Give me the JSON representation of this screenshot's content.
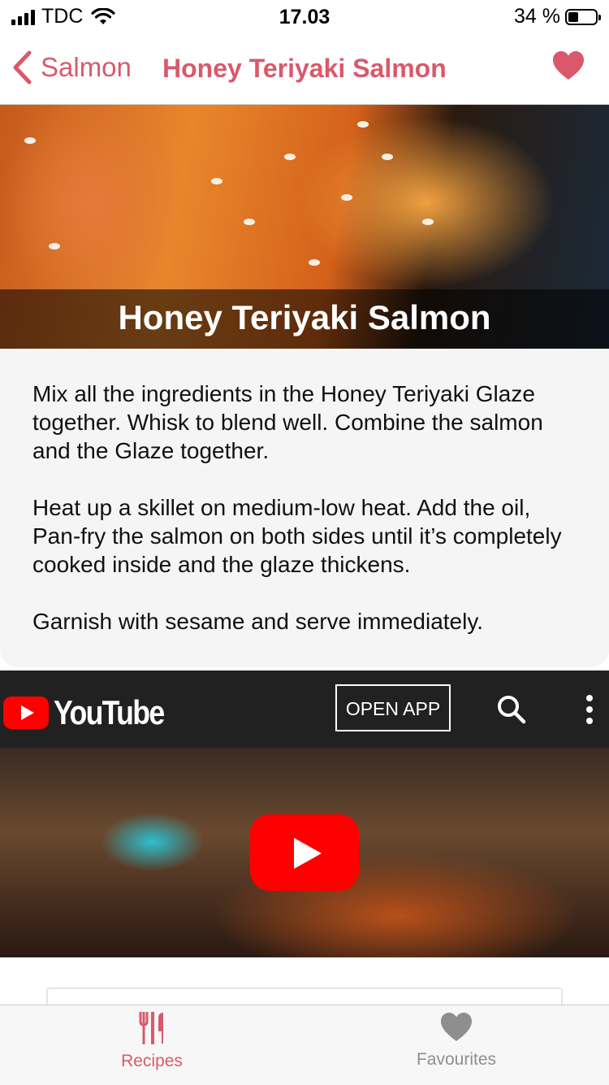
{
  "status_bar": {
    "carrier": "TDC",
    "time": "17.03",
    "battery": "34 %",
    "icons": [
      "signal-icon",
      "wifi-icon",
      "battery-icon"
    ]
  },
  "navbar": {
    "back_label": "Salmon",
    "title": "Honey Teriyaki Salmon",
    "icons": [
      "chevron-left-icon",
      "heart-icon"
    ]
  },
  "hero": {
    "title": "Honey Teriyaki Salmon"
  },
  "instructions": {
    "paragraphs": [
      "Mix all the ingredients in the Honey Teriyaki Glaze together. Whisk to blend well. Combine the salmon and the Glaze together.",
      "Heat up a skillet on medium-low heat. Add the oil, Pan-fry the salmon on both sides until it’s completely cooked inside and the glaze thickens.",
      "Garnish with sesame and serve immediately."
    ]
  },
  "youtube": {
    "logo_text": "YouTube",
    "open_app_label": "OPEN APP",
    "icons": [
      "youtube-logo-icon",
      "search-icon",
      "more-vertical-icon",
      "play-icon"
    ]
  },
  "tabbar": {
    "tabs": [
      {
        "label": "Recipes",
        "icon": "fork-knife-icon",
        "active": true
      },
      {
        "label": "Favourites",
        "icon": "heart-icon",
        "active": false
      }
    ]
  },
  "colors": {
    "accent": "#d9596b",
    "youtube_red": "#ff0000",
    "youtube_bar": "#212121",
    "inactive": "#8e8e8e"
  }
}
